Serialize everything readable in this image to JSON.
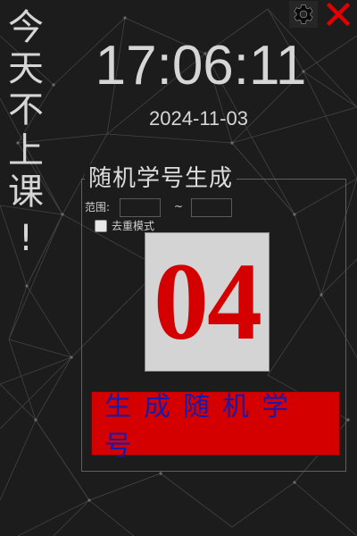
{
  "slogan": [
    "今",
    "天",
    "不",
    "上",
    "课",
    "!"
  ],
  "toolbar": {
    "settings_icon": "gear-icon",
    "close_icon": "close-icon"
  },
  "clock": {
    "time": "17:06:11",
    "date": "2024-11-03"
  },
  "generator": {
    "title": "随机学号生成",
    "range_label": "范围:",
    "range_separator": "~",
    "range_from": "",
    "range_to": "",
    "dedupe_label": "去重模式",
    "dedupe_checked": false,
    "result": "04",
    "button_label": "生成随机学号"
  },
  "colors": {
    "background": "#1c1c1c",
    "text": "#d6d6d6",
    "accent_red": "#d40000",
    "button_text_blue": "#1a1aa8",
    "result_bg": "#d4d4d4"
  }
}
